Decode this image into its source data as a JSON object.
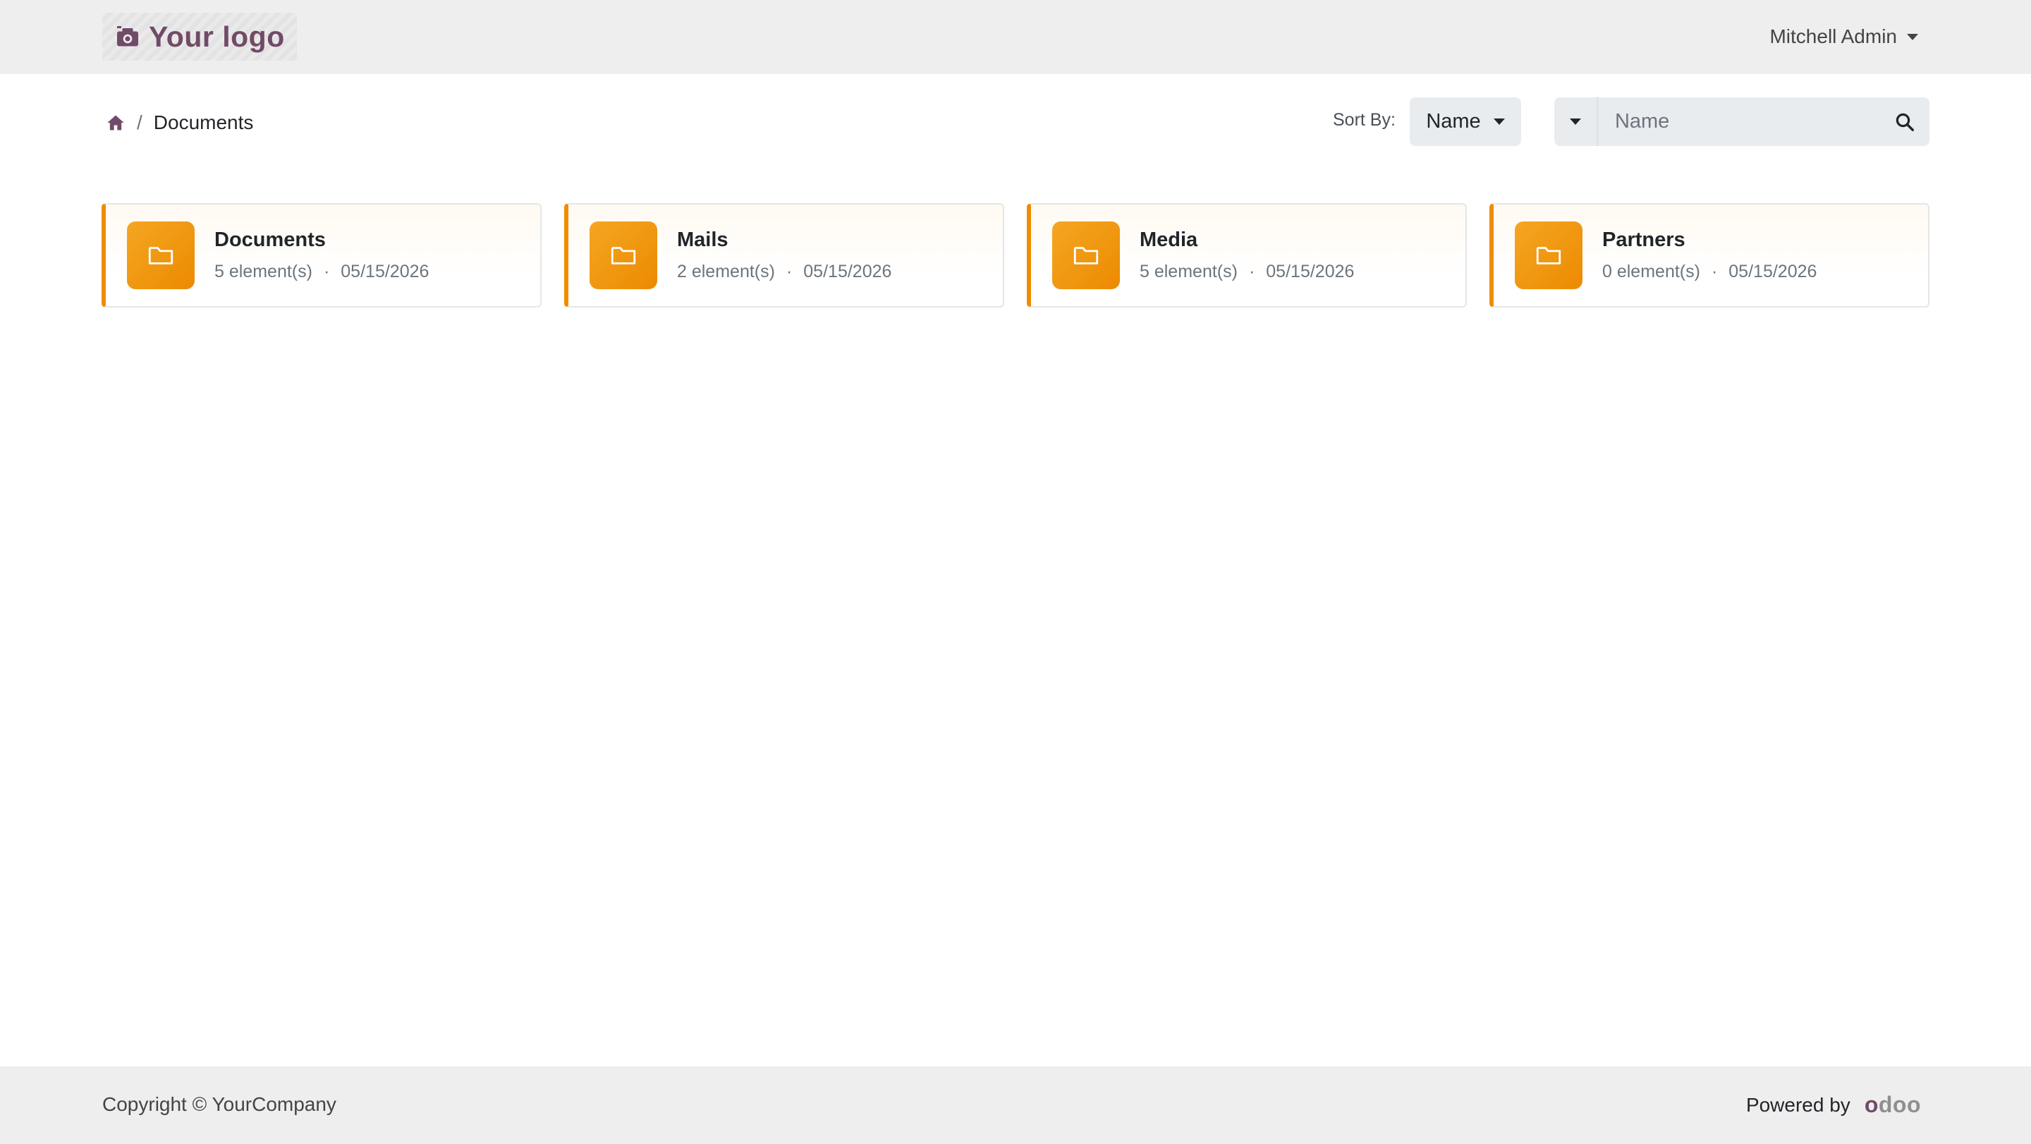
{
  "header": {
    "logo_text": "Your logo",
    "user_name": "Mitchell Admin"
  },
  "breadcrumb": {
    "current": "Documents",
    "separator": "/"
  },
  "toolbar": {
    "sort_label": "Sort By:",
    "sort_value": "Name",
    "search_placeholder": "Name"
  },
  "folders": [
    {
      "name": "Documents",
      "count": "5 element(s)",
      "date": "05/15/2026"
    },
    {
      "name": "Mails",
      "count": "2 element(s)",
      "date": "05/15/2026"
    },
    {
      "name": "Media",
      "count": "5 element(s)",
      "date": "05/15/2026"
    },
    {
      "name": "Partners",
      "count": "0 element(s)",
      "date": "05/15/2026"
    }
  ],
  "meta_separator": "·",
  "footer": {
    "copyright": "Copyright © YourCompany",
    "powered_by": "Powered by",
    "brand_first": "o",
    "brand_rest": "doo"
  },
  "colors": {
    "accent": "#714b67",
    "folder_orange": "#f08c00"
  }
}
